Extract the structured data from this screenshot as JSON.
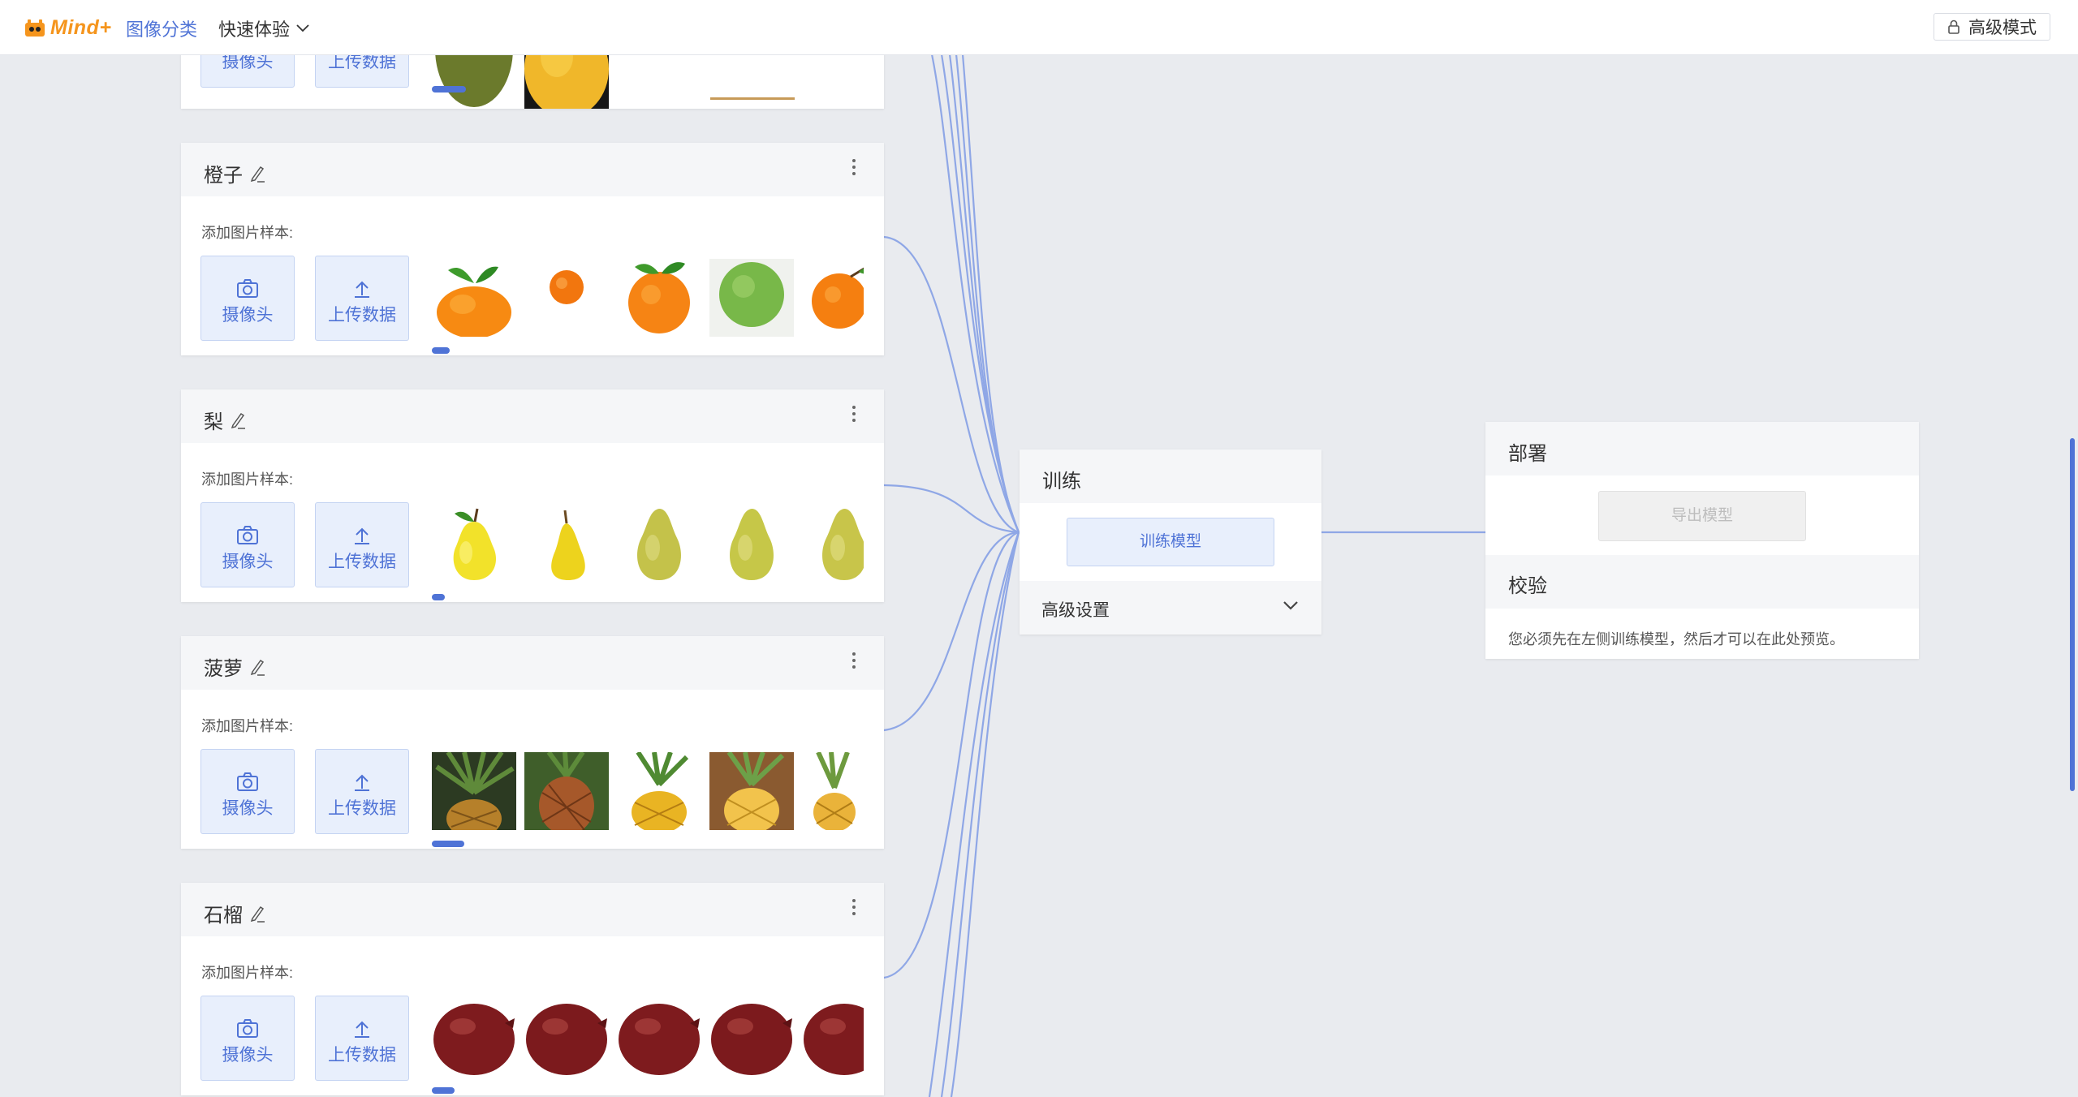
{
  "header": {
    "logo_text": "Mind+",
    "nav_active": "图像分类",
    "nav_dropdown": "快速体验",
    "advanced_mode": "高级模式"
  },
  "common": {
    "add_samples_label": "添加图片样本:",
    "camera_label": "摄像头",
    "upload_label": "上传数据"
  },
  "classes": [
    {
      "name": "",
      "thumbs": [
        "pear-green",
        "mango"
      ]
    },
    {
      "name": "橙子",
      "thumbs": [
        "orange-leaf",
        "orange-small",
        "orange-leaf-2",
        "green-citrus",
        "orange-branch"
      ]
    },
    {
      "name": "梨",
      "thumbs": [
        "pear-leaf",
        "pear-yellow",
        "pear-green",
        "pear-green",
        "pear-green"
      ]
    },
    {
      "name": "菠萝",
      "thumbs": [
        "pineapple",
        "pineapple",
        "pineapple",
        "pineapple",
        "pineapple"
      ]
    },
    {
      "name": "石榴",
      "thumbs": [
        "pomegranate",
        "pomegranate",
        "pomegranate",
        "pomegranate",
        "pomegranate"
      ]
    }
  ],
  "training": {
    "title": "训练",
    "train_button": "训练模型",
    "advanced_settings": "高级设置"
  },
  "deploy": {
    "title": "部署",
    "export_button": "导出模型",
    "verify_title": "校验",
    "verify_hint": "您必须先在左侧训练模型，然后才可以在此处预览。"
  },
  "colors": {
    "accent": "#4f73d6",
    "logo": "#f5951d",
    "background": "#e9ebef",
    "connector": "#8fa7e6"
  }
}
